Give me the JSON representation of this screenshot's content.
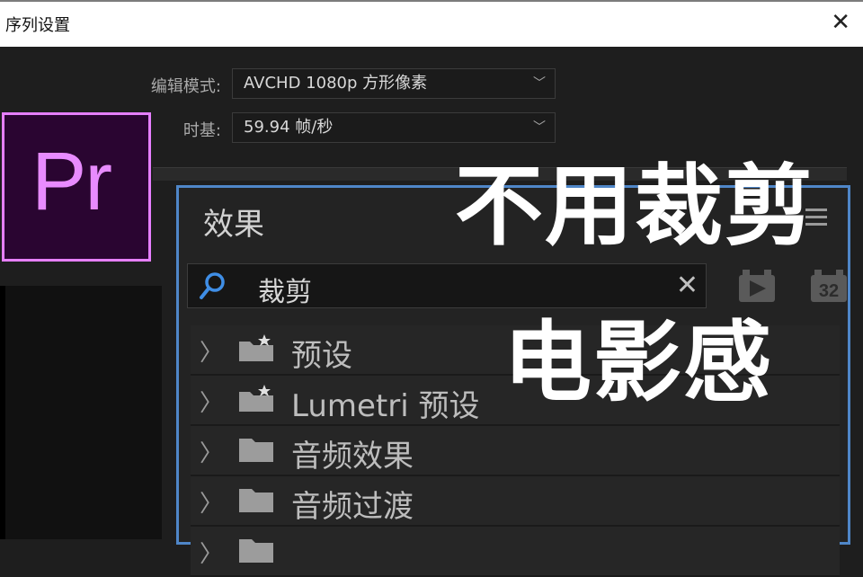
{
  "window": {
    "title": "序列设置",
    "close_glyph": "✕"
  },
  "form": {
    "edit_mode": {
      "label": "编辑模式:",
      "value": "AVCHD 1080p 方形像素"
    },
    "timebase": {
      "label": "时基:",
      "value": "59.94  帧/秒"
    }
  },
  "logo": {
    "text": "Pr",
    "border_color": "#e67fff",
    "bg_color": "#2a0531"
  },
  "effects_panel": {
    "title": "效果",
    "accent_color": "#4f86c8",
    "search": {
      "value": "裁剪",
      "clear_glyph": "✕",
      "icon": "search-icon"
    },
    "toolbar": [
      {
        "icon": "accelerated-effects-icon"
      },
      {
        "icon": "32bit-icon",
        "text": "32"
      }
    ],
    "tree": [
      {
        "label": "预设",
        "icon": "preset-folder-icon"
      },
      {
        "label": "Lumetri 预设",
        "icon": "preset-folder-icon"
      },
      {
        "label": "音频效果",
        "icon": "folder-icon"
      },
      {
        "label": "音频过渡",
        "icon": "folder-icon"
      },
      {
        "label": "",
        "icon": "folder-icon"
      }
    ]
  },
  "overlay": {
    "line1": "不用裁剪",
    "line2": "电影感"
  }
}
